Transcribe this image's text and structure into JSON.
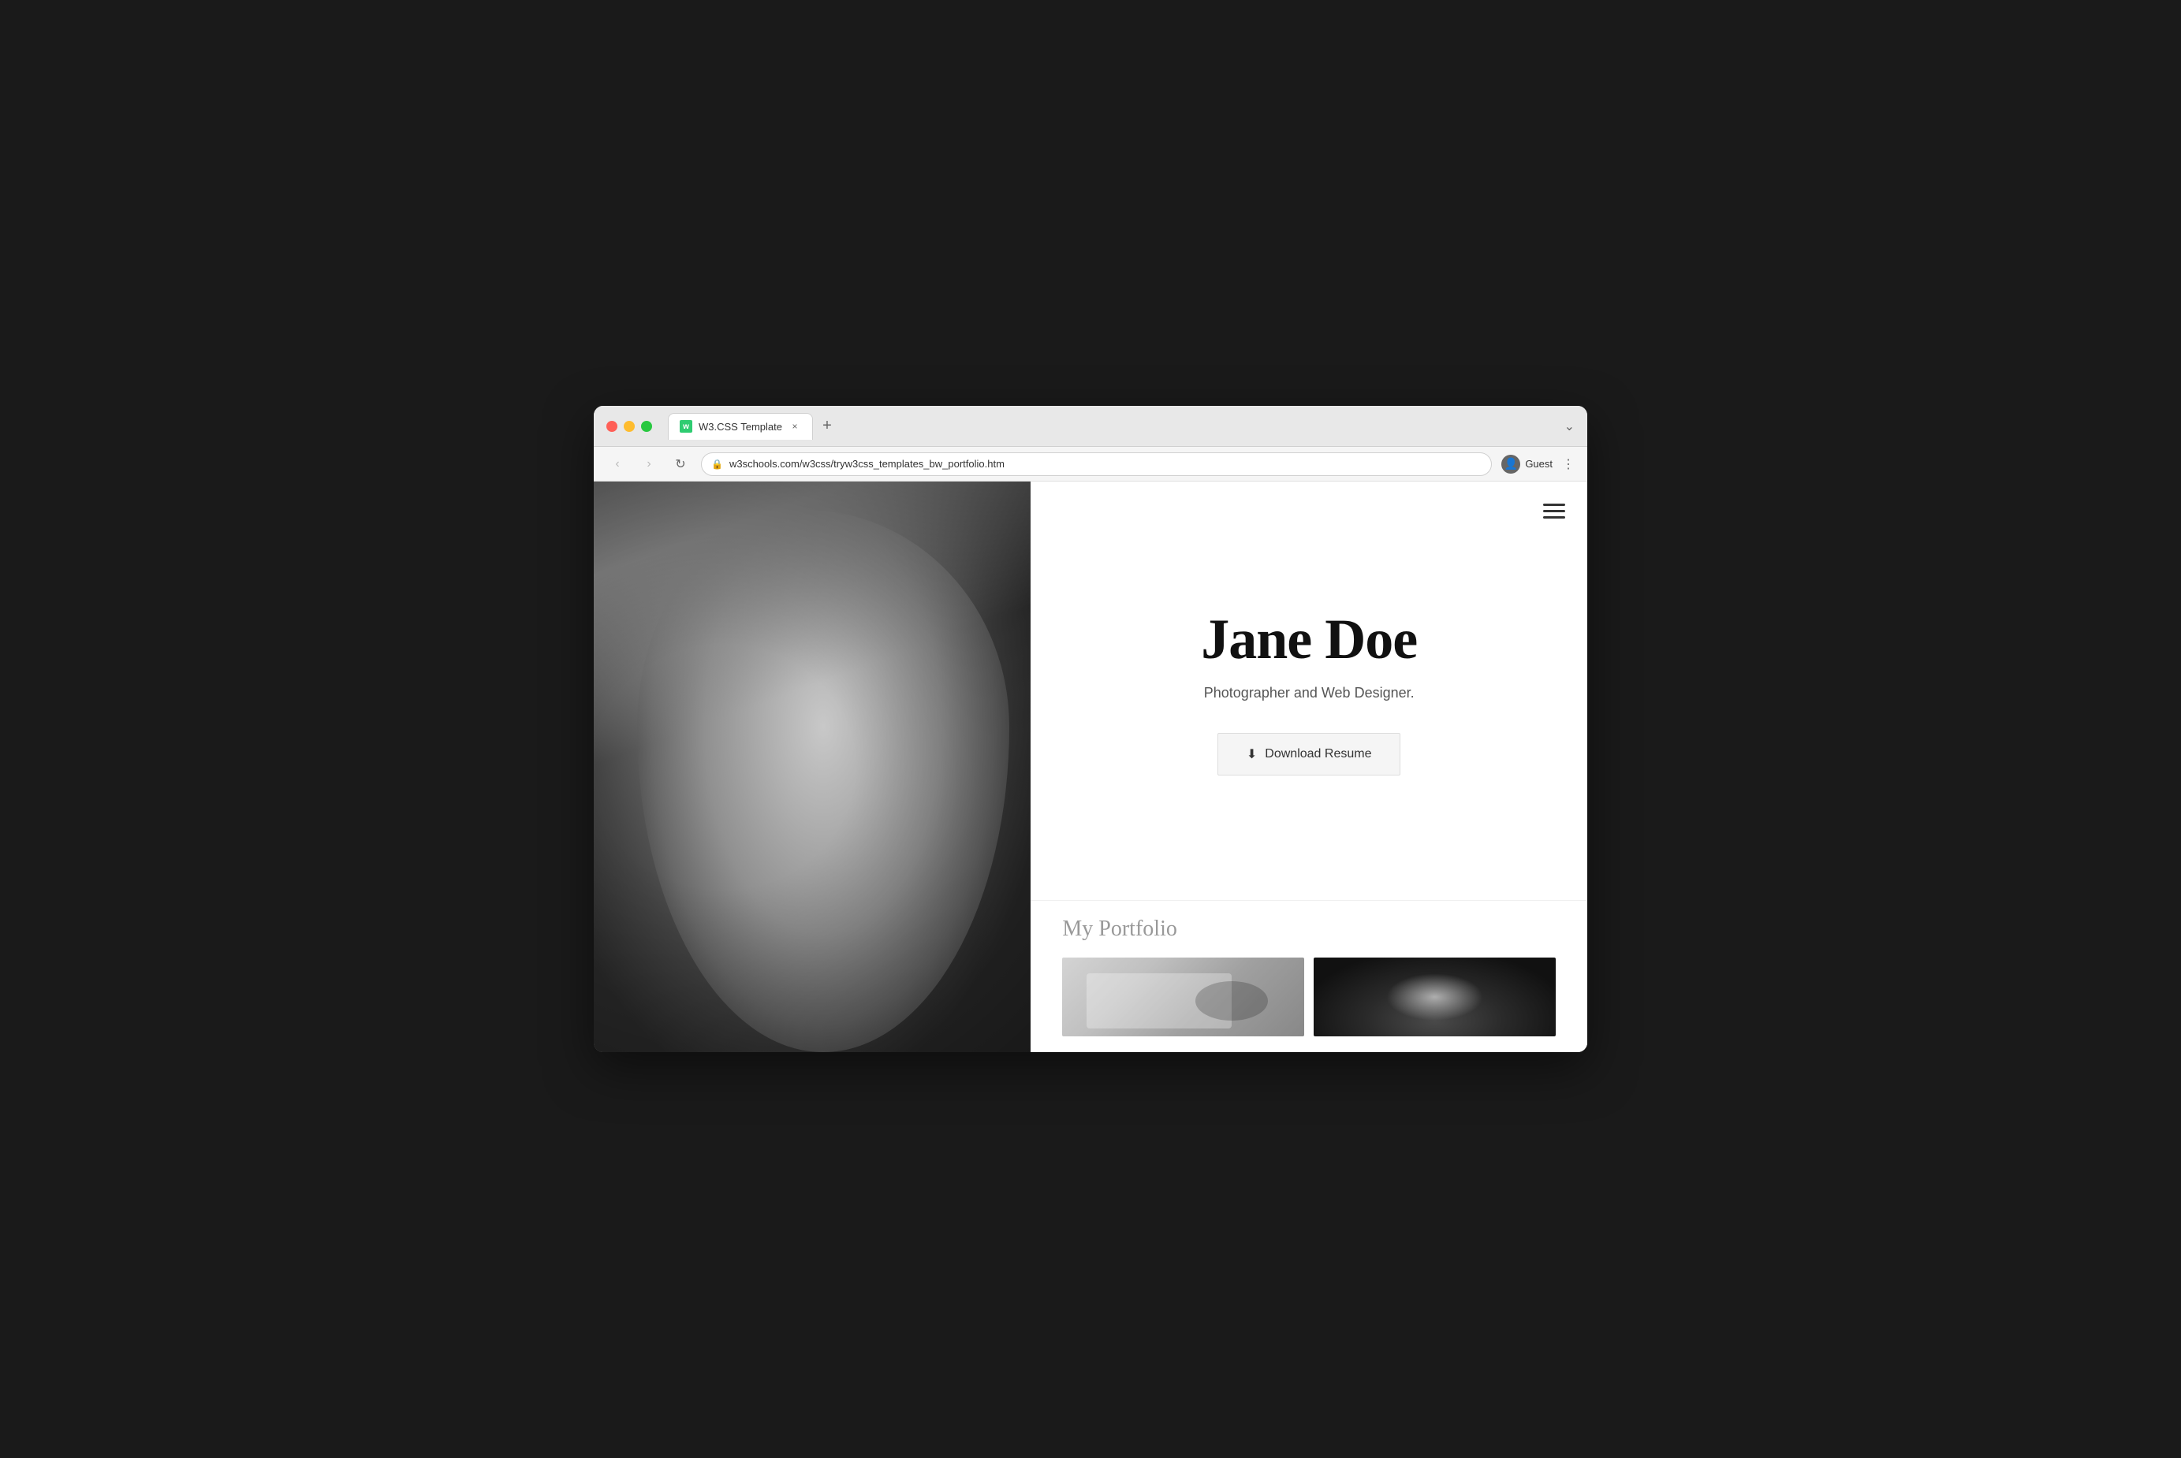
{
  "browser": {
    "tab_title": "W3.CSS Template",
    "tab_favicon": "w",
    "close_btn": "×",
    "new_tab_btn": "+",
    "nav_back": "‹",
    "nav_forward": "›",
    "nav_refresh": "↻",
    "url": "w3schools.com/w3css/tryw3css_templates_bw_portfolio.htm",
    "profile_label": "Guest",
    "dropdown_icon": "⌄"
  },
  "page": {
    "hamburger_label": "menu",
    "hero": {
      "name": "Jane Doe",
      "subtitle": "Photographer and Web Designer.",
      "download_btn": "Download Resume"
    },
    "portfolio": {
      "title": "My Portfolio"
    }
  }
}
